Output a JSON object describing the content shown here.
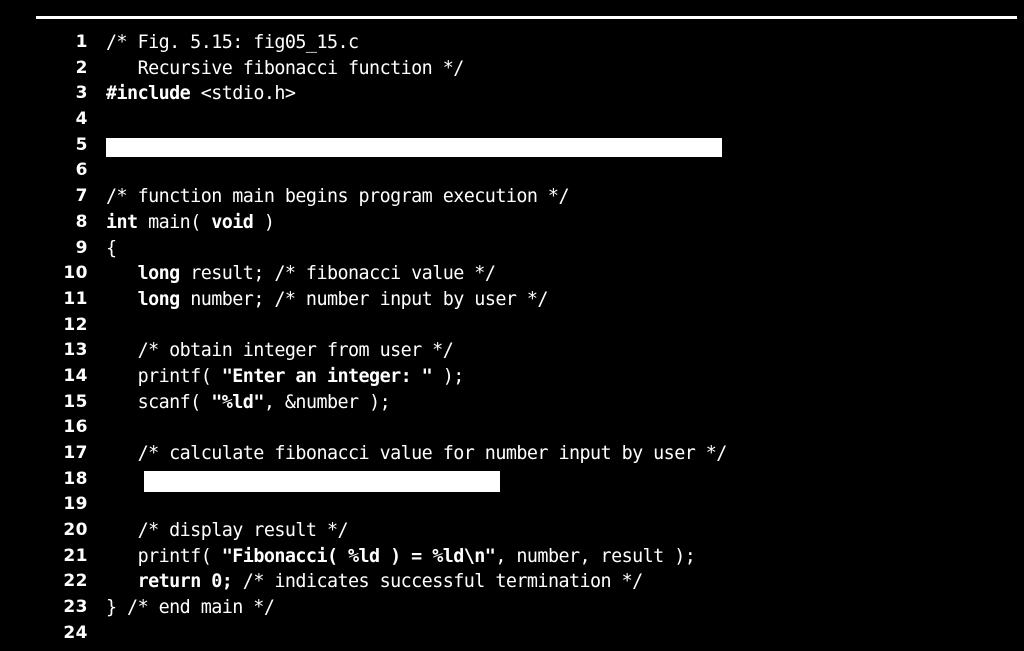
{
  "figure": {
    "caption_ref": "Fig. 5.15",
    "file_name": "fig05_15.c",
    "description": "Recursive fibonacci function"
  },
  "colors": {
    "background": "#000000",
    "text": "#ffffff",
    "redaction": "#ffffff",
    "rule": "#ffffff"
  },
  "listing": {
    "first_line": 1,
    "last_line": 24,
    "lines": [
      {
        "num": "1",
        "type": "code",
        "segments": [
          {
            "t": "/* Fig. 5.15: fig05_15.c",
            "b": false
          }
        ]
      },
      {
        "num": "2",
        "type": "code",
        "segments": [
          {
            "t": "   Recursive fibonacci function */",
            "b": false
          }
        ]
      },
      {
        "num": "3",
        "type": "code",
        "segments": [
          {
            "t": "#include",
            "b": true
          },
          {
            "t": " <stdio.h>",
            "b": false
          }
        ]
      },
      {
        "num": "4",
        "type": "blank",
        "segments": []
      },
      {
        "num": "5",
        "type": "redaction",
        "segments": [],
        "redaction": "redaction-5"
      },
      {
        "num": "6",
        "type": "blank",
        "segments": []
      },
      {
        "num": "7",
        "type": "code",
        "segments": [
          {
            "t": "/* function main begins program execution */",
            "b": false
          }
        ]
      },
      {
        "num": "8",
        "type": "code",
        "segments": [
          {
            "t": "int",
            "b": true
          },
          {
            "t": " main( ",
            "b": false
          },
          {
            "t": "void",
            "b": true
          },
          {
            "t": " )",
            "b": false
          }
        ]
      },
      {
        "num": "9",
        "type": "code",
        "segments": [
          {
            "t": "{",
            "b": false
          }
        ]
      },
      {
        "num": "10",
        "type": "code",
        "segments": [
          {
            "t": "   ",
            "b": false
          },
          {
            "t": "long",
            "b": true
          },
          {
            "t": " result; /* fibonacci value */",
            "b": false
          }
        ]
      },
      {
        "num": "11",
        "type": "code",
        "segments": [
          {
            "t": "   ",
            "b": false
          },
          {
            "t": "long",
            "b": true
          },
          {
            "t": " number; /* number input by user */",
            "b": false
          }
        ]
      },
      {
        "num": "12",
        "type": "blank",
        "segments": []
      },
      {
        "num": "13",
        "type": "code",
        "segments": [
          {
            "t": "   /* obtain integer from user */",
            "b": false
          }
        ]
      },
      {
        "num": "14",
        "type": "code",
        "segments": [
          {
            "t": "   printf( ",
            "b": false
          },
          {
            "t": "\"Enter an integer: \"",
            "b": true
          },
          {
            "t": " );",
            "b": false
          }
        ]
      },
      {
        "num": "15",
        "type": "code",
        "segments": [
          {
            "t": "   scanf( ",
            "b": false
          },
          {
            "t": "\"%ld\"",
            "b": true
          },
          {
            "t": ", &number );",
            "b": false
          }
        ]
      },
      {
        "num": "16",
        "type": "blank",
        "segments": []
      },
      {
        "num": "17",
        "type": "code",
        "segments": [
          {
            "t": "   /* calculate fibonacci value for number input by user */",
            "b": false
          }
        ]
      },
      {
        "num": "18",
        "type": "redaction",
        "segments": [],
        "redaction": "redaction-18"
      },
      {
        "num": "19",
        "type": "blank",
        "segments": []
      },
      {
        "num": "20",
        "type": "code",
        "segments": [
          {
            "t": "   /* display result */",
            "b": false
          }
        ]
      },
      {
        "num": "21",
        "type": "code",
        "segments": [
          {
            "t": "   printf( ",
            "b": false
          },
          {
            "t": "\"Fibonacci( %ld ) = %ld\\n\"",
            "b": true
          },
          {
            "t": ", number, result );",
            "b": false
          }
        ]
      },
      {
        "num": "22",
        "type": "code",
        "segments": [
          {
            "t": "   ",
            "b": false
          },
          {
            "t": "return 0;",
            "b": true
          },
          {
            "t": " /* indicates successful termination */",
            "b": false
          }
        ]
      },
      {
        "num": "23",
        "type": "code",
        "segments": [
          {
            "t": "} /* end main */",
            "b": false
          }
        ]
      },
      {
        "num": "24",
        "type": "blank",
        "segments": []
      }
    ]
  }
}
